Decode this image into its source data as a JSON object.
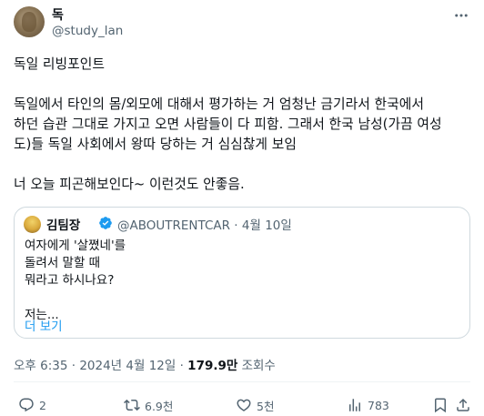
{
  "author": {
    "name": "독",
    "handle": "@study_lan"
  },
  "post": {
    "text": "독일 리빙포인트\n\n독일에서 타인의 몸/외모에 대해서 평가하는 거 엄청난 금기라서 한국에서\n하던 습관 그대로 가지고 오면 사람들이 다 피함. 그래서 한국 남성(가끔 여성\n도)들 독일 사회에서 왕따 당하는 거 심심찮게 보임\n\n너 오늘 피곤해보인다~ 이런것도 안좋음."
  },
  "quote": {
    "name": "김팀장",
    "handle_date": "@ABOUTRENTCAR · 4월 10일",
    "text": "여자에게 '살쪘네'를\n돌려서 말할 때\n뭐라고 하시나요?\n\n저는...",
    "more_label": "더 보기"
  },
  "meta": {
    "time_date": "오후 6:35 · 2024년 4월 12일 · ",
    "views_count": "179.9만",
    "views_label": " 조회수"
  },
  "actions": {
    "reply_count": "2",
    "retweet_count": "6.9천",
    "like_count": "5천",
    "view_count": "783"
  },
  "colors": {
    "accent": "#1d9bf0",
    "secondary_text": "#536471",
    "border": "#cfd9de"
  }
}
